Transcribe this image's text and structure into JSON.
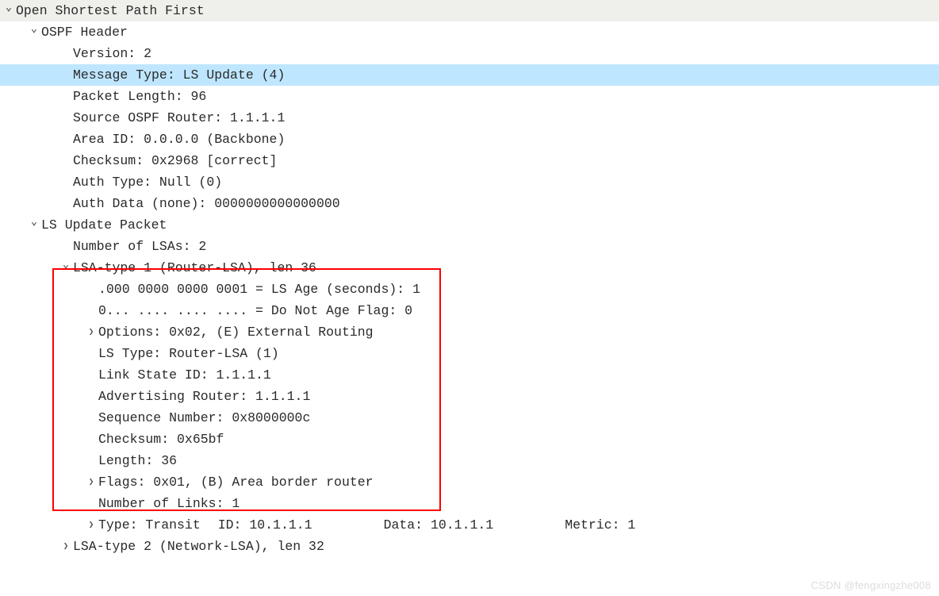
{
  "root": {
    "title": "Open Shortest Path First"
  },
  "ospf_header": {
    "title": "OSPF Header",
    "version": "Version: 2",
    "msg_type": "Message Type: LS Update (4)",
    "pkt_len": "Packet Length: 96",
    "src_router": "Source OSPF Router: 1.1.1.1",
    "area_id": "Area ID: 0.0.0.0 (Backbone)",
    "checksum": "Checksum: 0x2968 [correct]",
    "auth_type": "Auth Type: Null (0)",
    "auth_data": "Auth Data (none): 0000000000000000"
  },
  "ls_update": {
    "title": "LS Update Packet",
    "num_lsas": "Number of LSAs: 2"
  },
  "lsa1": {
    "title": "LSA-type 1 (Router-LSA), len 36",
    "ls_age": ".000 0000 0000 0001 = LS Age (seconds): 1",
    "dna_flag": "0... .... .... .... = Do Not Age Flag: 0",
    "options": "Options: 0x02, (E) External Routing",
    "ls_type": "LS Type: Router-LSA (1)",
    "link_state_id": "Link State ID: 1.1.1.1",
    "adv_router": "Advertising Router: 1.1.1.1",
    "seq_num": "Sequence Number: 0x8000000c",
    "checksum": "Checksum: 0x65bf",
    "length": "Length: 36",
    "flags": "Flags: 0x01, (B) Area border router",
    "num_links": "Number of Links: 1",
    "link_type": "Type: Transit",
    "link_id": "ID: 10.1.1.1",
    "link_data": "Data: 10.1.1.1",
    "link_metric": "Metric: 1"
  },
  "lsa2": {
    "title": "LSA-type 2 (Network-LSA), len 32"
  },
  "watermark": "CSDN @fengxingzhe008"
}
